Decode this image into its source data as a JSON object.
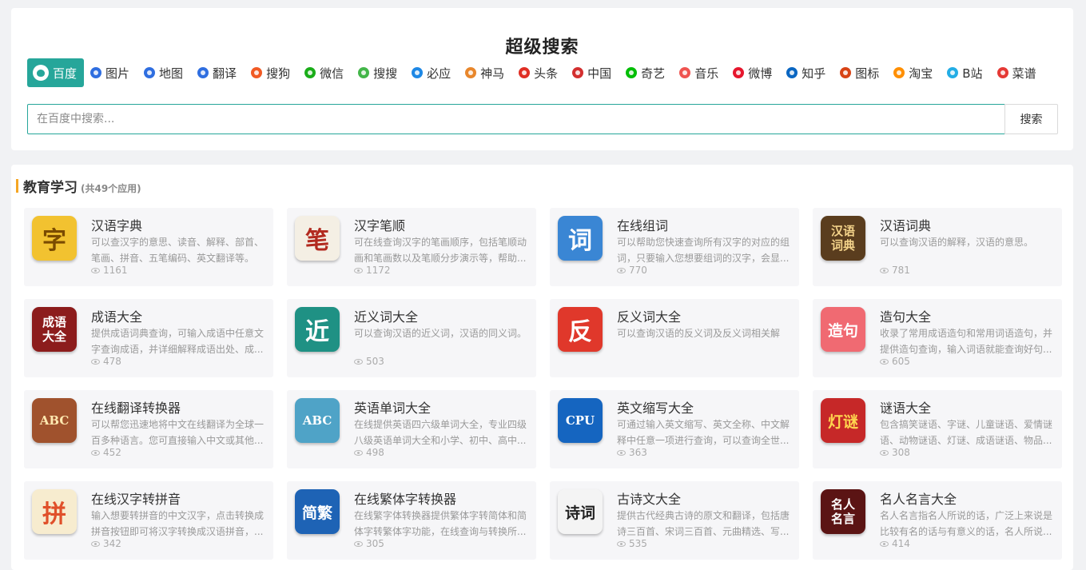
{
  "search": {
    "title": "超级搜索",
    "placeholder": "在百度中搜索...",
    "button_label": "搜索",
    "engines": [
      {
        "label": "百度",
        "icon": "baidu-paw-icon",
        "color": "#2f6ee0",
        "active": true
      },
      {
        "label": "图片",
        "icon": "baidu-paw-icon",
        "color": "#2f6ee0"
      },
      {
        "label": "地图",
        "icon": "baidu-paw-icon",
        "color": "#2f6ee0"
      },
      {
        "label": "翻译",
        "icon": "baidu-paw-icon",
        "color": "#2f6ee0"
      },
      {
        "label": "搜狗",
        "icon": "sogou-icon",
        "color": "#f15a24"
      },
      {
        "label": "微信",
        "icon": "wechat-icon",
        "color": "#1aad19"
      },
      {
        "label": "搜搜",
        "icon": "soso-icon",
        "color": "#43b649"
      },
      {
        "label": "必应",
        "icon": "bing-icon",
        "color": "#1e88e5"
      },
      {
        "label": "神马",
        "icon": "shenma-icon",
        "color": "#e8872c"
      },
      {
        "label": "头条",
        "icon": "toutiao-icon",
        "color": "#e02e24"
      },
      {
        "label": "中国",
        "icon": "chinaso-icon",
        "color": "#d32f2f"
      },
      {
        "label": "奇艺",
        "icon": "iqiyi-icon",
        "color": "#00be06"
      },
      {
        "label": "音乐",
        "icon": "music-icon",
        "color": "#ef5350"
      },
      {
        "label": "微博",
        "icon": "weibo-icon",
        "color": "#e6162d"
      },
      {
        "label": "知乎",
        "icon": "zhihu-icon",
        "color": "#0a66c2"
      },
      {
        "label": "图标",
        "icon": "icon-library-icon",
        "color": "#d84315"
      },
      {
        "label": "淘宝",
        "icon": "taobao-icon",
        "color": "#ff8f00"
      },
      {
        "label": "B站",
        "icon": "bilibili-icon",
        "color": "#23ade5"
      },
      {
        "label": "菜谱",
        "icon": "recipe-icon",
        "color": "#e53935"
      }
    ]
  },
  "category": {
    "title": "教育学习",
    "count_label": "(共49个应用)",
    "accent": "#f5a623"
  },
  "apps": [
    {
      "name": "汉语字典",
      "desc": "可以查汉字的意思、读音、解释、部首、笔画、拼音、五笔编码、英文翻译等。",
      "views": "1161",
      "glyph": "字",
      "bg": "#f2c230",
      "fg": "#7a4b00",
      "icon": "dictionary-book-icon"
    },
    {
      "name": "汉字笔顺",
      "desc": "可在线查询汉字的笔画顺序，包括笔顺动画和笔画数以及笔顺分步演示等，帮助...",
      "views": "1172",
      "glyph": "笔",
      "bg": "#f4efe4",
      "fg": "#b22a1f",
      "icon": "brush-calligraphy-icon"
    },
    {
      "name": "在线组词",
      "desc": "可以帮助您快速查询所有汉字的对应的组词，只要输入您想要组词的汉字，会显...",
      "views": "770",
      "glyph": "词",
      "bg": "#3a86d4",
      "fg": "#ffffff",
      "icon": "graduation-cap-icon"
    },
    {
      "name": "汉语词典",
      "desc": "可以查询汉语的解释，汉语的意思。",
      "views": "781",
      "glyph": "汉语词典",
      "bg": "#5a3d1e",
      "fg": "#f3d28a",
      "icon": "chinese-dictionary-icon"
    },
    {
      "name": "成语大全",
      "desc": "提供成语词典查询，可输入成语中任意文字查询成语，并详细解释成语出处、成...",
      "views": "478",
      "glyph": "成语大全",
      "bg": "#8c1c1c",
      "fg": "#ffffff",
      "icon": "idiom-book-icon"
    },
    {
      "name": "近义词大全",
      "desc": "可以查询汉语的近义词，汉语的同义词。",
      "views": "503",
      "glyph": "近",
      "bg": "#1f9184",
      "fg": "#ffffff",
      "icon": "synonym-icon"
    },
    {
      "name": "反义词大全",
      "desc": "可以查询汉语的反义词及反义词相关解",
      "views": "",
      "glyph": "反",
      "bg": "#e0382b",
      "fg": "#ffffff",
      "icon": "antonym-icon"
    },
    {
      "name": "造句大全",
      "desc": "收录了常用成语造句和常用词语造句，并提供造句查询，输入词语就能查询好句...",
      "views": "605",
      "glyph": "造句",
      "bg": "#f06a72",
      "fg": "#ffffff",
      "icon": "sentence-making-icon"
    },
    {
      "name": "在线翻译转换器",
      "desc": "可以帮您迅速地将中文在线翻译为全球一百多种语言。您可直接输入中文或其他...",
      "views": "452",
      "glyph": "ABC",
      "bg": "#a0522d",
      "fg": "#ffe9b0",
      "icon": "translator-device-icon"
    },
    {
      "name": "英语单词大全",
      "desc": "在线提供英语四六级单词大全，专业四级八级英语单词大全和小学、初中、高中...",
      "views": "498",
      "glyph": "ABC",
      "bg": "#4fa3c7",
      "fg": "#ffffff",
      "icon": "abc-book-icon"
    },
    {
      "name": "英文缩写大全",
      "desc": "可通过输入英文缩写、英文全称、中文解释中任意一项进行查询，可以查询全世...",
      "views": "363",
      "glyph": "CPU",
      "bg": "#1565c0",
      "fg": "#ffffff",
      "icon": "abbreviation-cpu-icon"
    },
    {
      "name": "谜语大全",
      "desc": "包含搞笑谜语、字谜、儿童谜语、爱情谜语、动物谜语、灯谜、成语谜语、物品...",
      "views": "308",
      "glyph": "灯谜",
      "bg": "#c62828",
      "fg": "#ffd54f",
      "icon": "lantern-riddle-icon"
    },
    {
      "name": "在线汉字转拼音",
      "desc": "输入想要转拼音的中文汉字，点击转换成拼音按钮即可将汉字转换成汉语拼音，...",
      "views": "342",
      "glyph": "拼",
      "bg": "#f7eccf",
      "fg": "#e0502a",
      "icon": "pinyin-icon"
    },
    {
      "name": "在线繁体字转换器",
      "desc": "在线繁字体转换器提供繁体字转简体和简体字转繁体字功能，在线查询与转换所...",
      "views": "305",
      "glyph": "简繁",
      "bg": "#1e63b5",
      "fg": "#ffffff",
      "icon": "traditional-simplified-icon"
    },
    {
      "name": "古诗文大全",
      "desc": "提供古代经典古诗的原文和翻译，包括唐诗三百首、宋词三百首、元曲精选、写...",
      "views": "535",
      "glyph": "诗词",
      "bg": "#f4f4f4",
      "fg": "#222222",
      "icon": "poetry-icon"
    },
    {
      "name": "名人名言大全",
      "desc": "名人名言指名人所说的话，广泛上来说是比较有名的话与有意义的话，名人所说...",
      "views": "414",
      "glyph": "名人名言",
      "bg": "#5b1414",
      "fg": "#ffffff",
      "icon": "famous-quotes-icon"
    }
  ]
}
